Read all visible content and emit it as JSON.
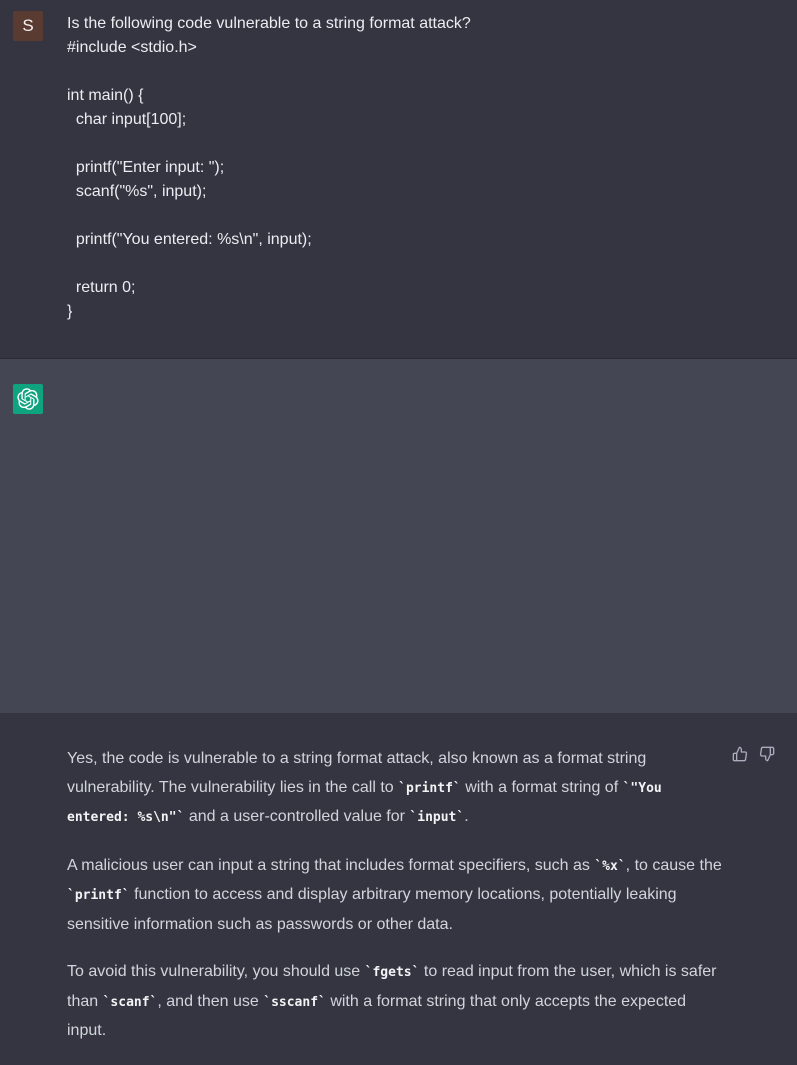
{
  "user": {
    "avatar_letter": "S",
    "lines": [
      "Is the following code vulnerable to a string format attack?",
      "#include <stdio.h>",
      "",
      "int main() {",
      "  char input[100];",
      "",
      "  printf(\"Enter input: \");",
      "  scanf(\"%s\", input);",
      "",
      "  printf(\"You entered: %s\\n\", input);",
      "",
      "  return 0;",
      "}"
    ]
  },
  "assistant": {
    "paragraphs": [
      [
        {
          "t": "text",
          "v": "Yes, the code is vulnerable to a string format attack, also known as a format string vulnerability. The vulnerability lies in the call to "
        },
        {
          "t": "code",
          "v": "`printf`"
        },
        {
          "t": "text",
          "v": " with a format string of "
        },
        {
          "t": "code",
          "v": "`\"You entered: %s\\n\"`"
        },
        {
          "t": "text",
          "v": " and a user-controlled value for "
        },
        {
          "t": "code",
          "v": "`input`"
        },
        {
          "t": "text",
          "v": "."
        }
      ],
      [
        {
          "t": "text",
          "v": "A malicious user can input a string that includes format specifiers, such as "
        },
        {
          "t": "code",
          "v": "`%x`"
        },
        {
          "t": "text",
          "v": ", to cause the "
        },
        {
          "t": "code",
          "v": "`printf`"
        },
        {
          "t": "text",
          "v": " function to access and display arbitrary memory locations, potentially leaking sensitive information such as passwords or other data."
        }
      ],
      [
        {
          "t": "text",
          "v": "To avoid this vulnerability, you should use "
        },
        {
          "t": "code",
          "v": "`fgets`"
        },
        {
          "t": "text",
          "v": " to read input from the user, which is safer than "
        },
        {
          "t": "code",
          "v": "`scanf`"
        },
        {
          "t": "text",
          "v": ", and then use "
        },
        {
          "t": "code",
          "v": "`sscanf`"
        },
        {
          "t": "text",
          "v": " with a format string that only accepts the expected input."
        }
      ]
    ]
  },
  "icons": {
    "assistant_avatar": "openai-logo-icon",
    "like": "thumbs-up-icon",
    "dislike": "thumbs-down-icon"
  },
  "colors": {
    "user_bg": "#343541",
    "assistant_bg": "#444654",
    "user_avatar": "#5a3b32",
    "assistant_avatar": "#10a37f"
  }
}
